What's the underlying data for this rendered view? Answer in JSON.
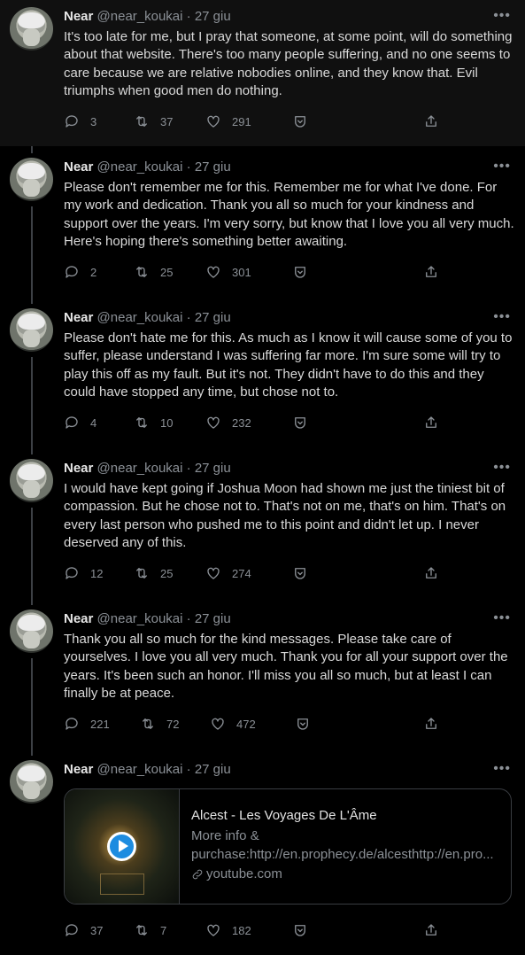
{
  "tweets": [
    {
      "name": "Near",
      "handle": "@near_koukai",
      "dot": "·",
      "date": "27 giu",
      "more": "•••",
      "text": "It's too late for me, but I pray that someone, at some point, will do something about that website. There's too many people suffering, and no one seems to care because we are relative nobodies online, and they know that. Evil triumphs when good men do nothing.",
      "replies": "3",
      "retweets": "37",
      "likes": "291"
    },
    {
      "name": "Near",
      "handle": "@near_koukai",
      "dot": "·",
      "date": "27 giu",
      "more": "•••",
      "text": "Please don't remember me for this. Remember me for what I've done. For my work and dedication. Thank you all so much for your kindness and support over the years. I'm very sorry, but know that I love you all very much. Here's hoping there's something better awaiting.",
      "replies": "2",
      "retweets": "25",
      "likes": "301"
    },
    {
      "name": "Near",
      "handle": "@near_koukai",
      "dot": "·",
      "date": "27 giu",
      "more": "•••",
      "text": "Please don't hate me for this. As much as I know it will cause some of you to suffer, please understand I was suffering far more. I'm sure some will try to play this off as my fault. But it's not. They didn't have to do this and they could have stopped any time, but chose not to.",
      "replies": "4",
      "retweets": "10",
      "likes": "232"
    },
    {
      "name": "Near",
      "handle": "@near_koukai",
      "dot": "·",
      "date": "27 giu",
      "more": "•••",
      "text": "I would have kept going if Joshua Moon had shown me just the tiniest bit of compassion. But he chose not to. That's not on me, that's on him. That's on every last person who pushed me to this point and didn't let up. I never deserved any of this.",
      "replies": "12",
      "retweets": "25",
      "likes": "274"
    },
    {
      "name": "Near",
      "handle": "@near_koukai",
      "dot": "·",
      "date": "27 giu",
      "more": "•••",
      "text": "Thank you all so much for the kind messages. Please take care of yourselves. I love you all very much. Thank you for all your support over the years. It's been such an honor. I'll miss you all so much, but at least I can finally be at peace.",
      "replies": "221",
      "retweets": "72",
      "likes": "472"
    },
    {
      "name": "Near",
      "handle": "@near_koukai",
      "dot": "·",
      "date": "27 giu",
      "more": "•••",
      "card": {
        "title": "Alcest - Les Voyages De L'Âme",
        "desc1": "More info &",
        "desc2": "purchase:http://en.prophecy.de/alcesthttp://en.pro...",
        "domain": "youtube.com"
      },
      "replies": "37",
      "retweets": "7",
      "likes": "182"
    }
  ]
}
